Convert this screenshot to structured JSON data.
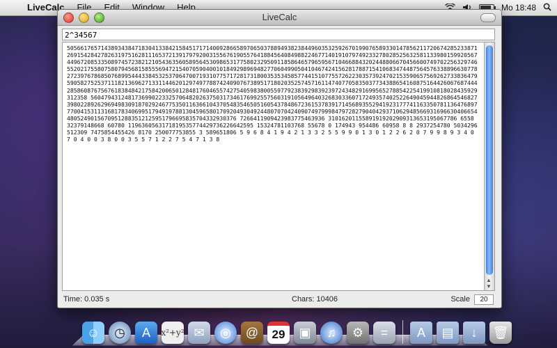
{
  "menubar": {
    "apple_glyph": "",
    "app_name": "LiveCalc",
    "items": [
      "File",
      "Edit",
      "Window",
      "Help"
    ],
    "clock": "Mo 18:48",
    "icons": {
      "wifi": "wifi-icon",
      "sound": "speaker-icon",
      "battery": "battery-icon",
      "spotlight": "spotlight-icon"
    },
    "battery_level": 0.85
  },
  "window": {
    "title": "LiveCalc",
    "expression": "2^34567",
    "output": "5056617657143893438471830413384215845171714009286658970650378894938238449603532592670199076589330147856211720674285233871269154284278263197516281116537213917979200315567619055764188456408498822467714019107974923327802852563258113398015992056744967208533508974572382121054363560589564530986531775802329509118586465796595671046688432024488066704566007497022563297465520217558075807945681585556947215407059040010184929896948277060499050410467424156281788715410683474487564576338896630778272397678685076899544433845325370647007193107757172817318003535345857744151077557262230357392470215359065756926273383647959058275253711182136962713311446201297497788742409076738951718020352574571611474077058350377343886541608751644260676874442858608767567618384842175842006501284817604655742754059838005597792383929839239724348291699565278854225419910818028435929312358 5604794312481736990223325706482026375031734617699255756031910564964032683033607172493574025226490459448268645468273980228926296949830918702924677535011636610437054835465051605437848672361537839171456893552941923177741163350781136476897770041531131681783406995179491978813045965801709204930492448070704240907497999847972827904042937106294856693169663040665448052490156709512883512125951796695835704332930376 7266411909423983775463936 31016201155891919202909313653195067786 6558 32379148668 60780 1196360563171819535774429736226642595 15324781103768 55678 0 174943 954486 60958 8 8 2937254780 5034296512309 7475854455426 8170 250077753855 3 589651806 5 9 6 8 4 1 9 4 2 1 3 3 2 5 5 9 9 0 1 3 0 1 2 2 6 2 0 7 9 9 8 9 3 4 0 7 0 4 0 0 3 8 0 0 3 5 5 7 1 2 2 7 5 4 7 1 3 8",
    "status": {
      "time": "Time: 0.035 s",
      "chars": "Chars: 10406",
      "scale_label": "Scale",
      "scale_value": "20"
    },
    "scroll_position": 0.0
  },
  "dock": {
    "apps": [
      {
        "name": "finder-icon",
        "glyph": "☺"
      },
      {
        "name": "time-machine-icon",
        "glyph": "◷"
      },
      {
        "name": "app-store-icon",
        "glyph": "A"
      },
      {
        "name": "grapher-icon",
        "glyph": "x²+y²"
      },
      {
        "name": "mail-icon",
        "glyph": "✉"
      },
      {
        "name": "safari-icon",
        "glyph": "◎"
      },
      {
        "name": "address-book-icon",
        "glyph": "@"
      },
      {
        "name": "ical-icon",
        "glyph": "29"
      },
      {
        "name": "iphoto-icon",
        "glyph": "▣"
      },
      {
        "name": "itunes-icon",
        "glyph": "♫"
      },
      {
        "name": "system-preferences-icon",
        "glyph": "⚙"
      },
      {
        "name": "livecalc-icon",
        "glyph": "="
      }
    ],
    "stacks": [
      {
        "name": "applications-folder-icon",
        "glyph": "A"
      },
      {
        "name": "documents-folder-icon",
        "glyph": "▤"
      },
      {
        "name": "downloads-folder-icon",
        "glyph": "↓"
      },
      {
        "name": "trash-icon",
        "glyph": "🗑"
      }
    ]
  }
}
